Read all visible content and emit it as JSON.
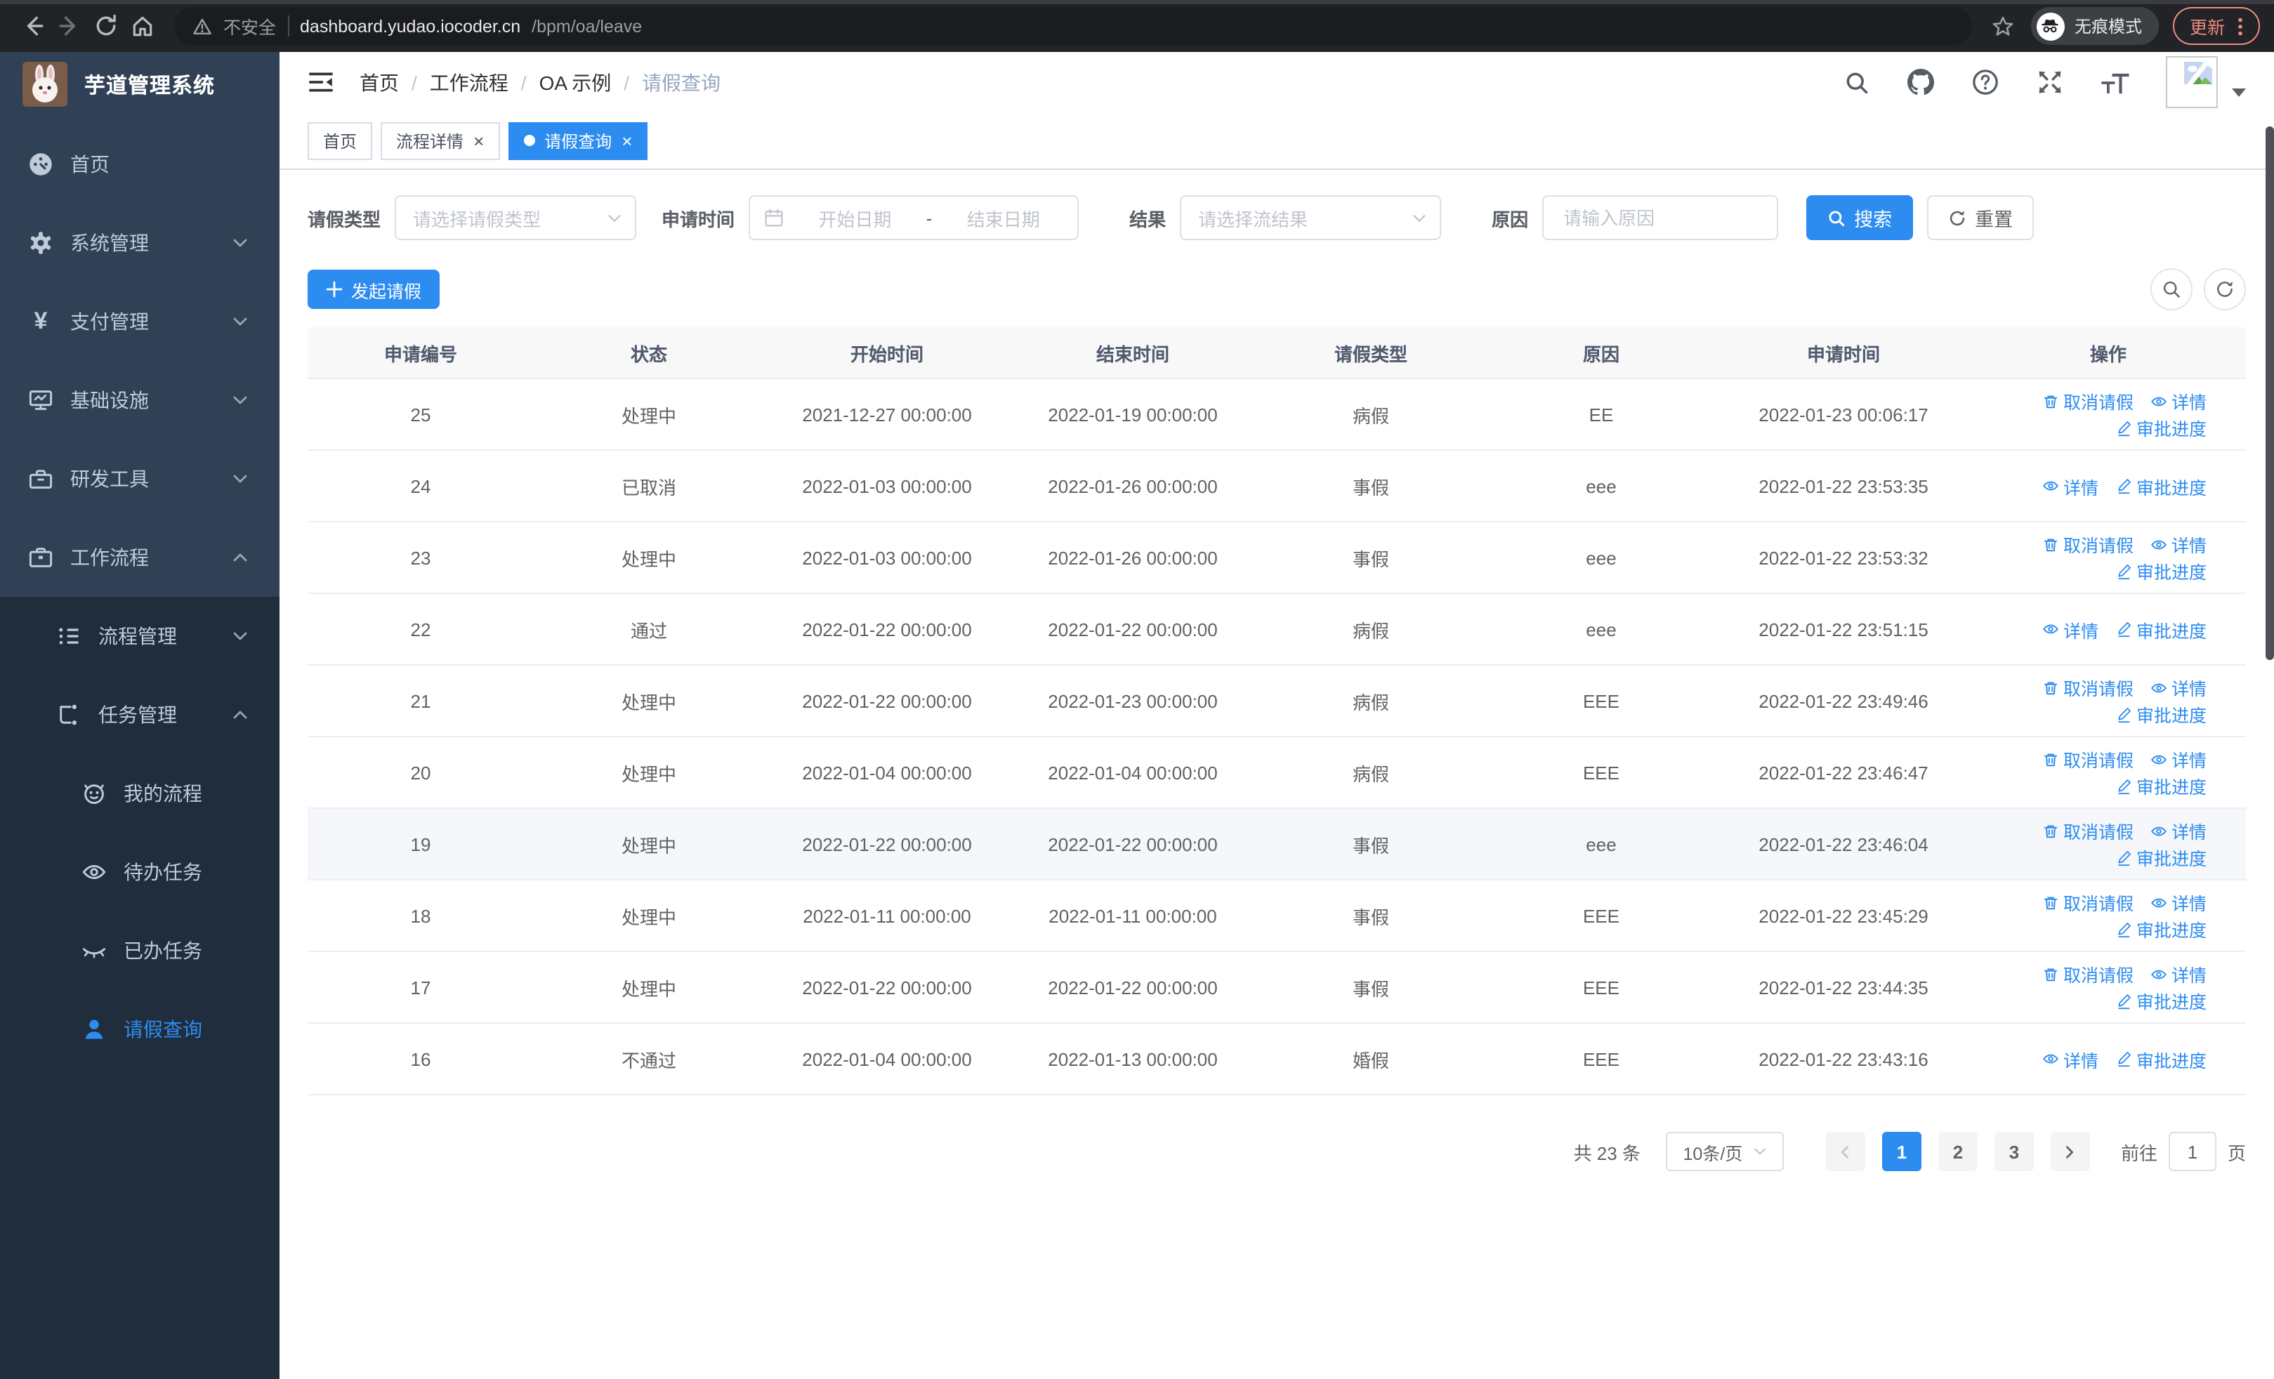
{
  "colors": {
    "primary": "#2d8cf0",
    "sidebar_bg": "#304156",
    "sidebar_submenu_bg": "#1f2d3d",
    "sidebar_text": "#bfcbd9",
    "chrome_accent": "#ef8b80",
    "table_header_bg": "#f8f8f9",
    "row_highlight": "#f5f7fa"
  },
  "browser": {
    "security_warning": "不安全",
    "url_host": "dashboard.yudao.iocoder.cn",
    "url_path": "/bpm/oa/leave",
    "incognito_label": "无痕模式",
    "update_label": "更新"
  },
  "sidebar": {
    "app_title": "芋道管理系统",
    "items": [
      {
        "label": "首页"
      },
      {
        "label": "系统管理"
      },
      {
        "label": "支付管理"
      },
      {
        "label": "基础设施"
      },
      {
        "label": "研发工具"
      },
      {
        "label": "工作流程"
      },
      {
        "label": "流程管理"
      },
      {
        "label": "任务管理"
      },
      {
        "label": "我的流程"
      },
      {
        "label": "待办任务"
      },
      {
        "label": "已办任务"
      },
      {
        "label": "请假查询"
      }
    ]
  },
  "breadcrumb": [
    "首页",
    "工作流程",
    "OA 示例",
    "请假查询"
  ],
  "ui": {
    "breadcrumb_separator": "/",
    "close_glyph": "×"
  },
  "tabs": [
    {
      "label": "首页",
      "closable": false,
      "active": false
    },
    {
      "label": "流程详情",
      "closable": true,
      "active": false
    },
    {
      "label": "请假查询",
      "closable": true,
      "active": true
    }
  ],
  "filters": {
    "leave_type_label": "请假类型",
    "leave_type_placeholder": "请选择请假类型",
    "apply_time_label": "申请时间",
    "start_date_placeholder": "开始日期",
    "range_separator": "-",
    "end_date_placeholder": "结束日期",
    "result_label": "结果",
    "result_placeholder": "请选择流结果",
    "reason_label": "原因",
    "reason_placeholder": "请输入原因",
    "search_button": "搜索",
    "reset_button": "重置"
  },
  "toolbar": {
    "create_button": "发起请假"
  },
  "table": {
    "columns": [
      "申请编号",
      "状态",
      "开始时间",
      "结束时间",
      "请假类型",
      "原因",
      "申请时间",
      "操作"
    ],
    "actions": {
      "cancel": "取消请假",
      "detail": "详情",
      "progress": "审批进度"
    },
    "rows": [
      {
        "id": "25",
        "status": "处理中",
        "start_time": "2021-12-27 00:00:00",
        "end_time": "2022-01-19 00:00:00",
        "leave_type": "病假",
        "reason": "EE",
        "apply_time": "2022-01-23 00:06:17",
        "can_cancel": true,
        "highlighted": false
      },
      {
        "id": "24",
        "status": "已取消",
        "start_time": "2022-01-03 00:00:00",
        "end_time": "2022-01-26 00:00:00",
        "leave_type": "事假",
        "reason": "eee",
        "apply_time": "2022-01-22 23:53:35",
        "can_cancel": false,
        "highlighted": false
      },
      {
        "id": "23",
        "status": "处理中",
        "start_time": "2022-01-03 00:00:00",
        "end_time": "2022-01-26 00:00:00",
        "leave_type": "事假",
        "reason": "eee",
        "apply_time": "2022-01-22 23:53:32",
        "can_cancel": true,
        "highlighted": false
      },
      {
        "id": "22",
        "status": "通过",
        "start_time": "2022-01-22 00:00:00",
        "end_time": "2022-01-22 00:00:00",
        "leave_type": "病假",
        "reason": "eee",
        "apply_time": "2022-01-22 23:51:15",
        "can_cancel": false,
        "highlighted": false
      },
      {
        "id": "21",
        "status": "处理中",
        "start_time": "2022-01-22 00:00:00",
        "end_time": "2022-01-23 00:00:00",
        "leave_type": "病假",
        "reason": "EEE",
        "apply_time": "2022-01-22 23:49:46",
        "can_cancel": true,
        "highlighted": false
      },
      {
        "id": "20",
        "status": "处理中",
        "start_time": "2022-01-04 00:00:00",
        "end_time": "2022-01-04 00:00:00",
        "leave_type": "病假",
        "reason": "EEE",
        "apply_time": "2022-01-22 23:46:47",
        "can_cancel": true,
        "highlighted": false
      },
      {
        "id": "19",
        "status": "处理中",
        "start_time": "2022-01-22 00:00:00",
        "end_time": "2022-01-22 00:00:00",
        "leave_type": "事假",
        "reason": "eee",
        "apply_time": "2022-01-22 23:46:04",
        "can_cancel": true,
        "highlighted": true
      },
      {
        "id": "18",
        "status": "处理中",
        "start_time": "2022-01-11 00:00:00",
        "end_time": "2022-01-11 00:00:00",
        "leave_type": "事假",
        "reason": "EEE",
        "apply_time": "2022-01-22 23:45:29",
        "can_cancel": true,
        "highlighted": false
      },
      {
        "id": "17",
        "status": "处理中",
        "start_time": "2022-01-22 00:00:00",
        "end_time": "2022-01-22 00:00:00",
        "leave_type": "事假",
        "reason": "EEE",
        "apply_time": "2022-01-22 23:44:35",
        "can_cancel": true,
        "highlighted": false
      },
      {
        "id": "16",
        "status": "不通过",
        "start_time": "2022-01-04 00:00:00",
        "end_time": "2022-01-13 00:00:00",
        "leave_type": "婚假",
        "reason": "EEE",
        "apply_time": "2022-01-22 23:43:16",
        "can_cancel": false,
        "highlighted": false
      }
    ]
  },
  "pagination": {
    "total_text": "共 23 条",
    "page_size": "10条/页",
    "pages": [
      "1",
      "2",
      "3"
    ],
    "active_page": "1",
    "goto_label": "前往",
    "goto_value": "1",
    "page_unit": "页"
  }
}
